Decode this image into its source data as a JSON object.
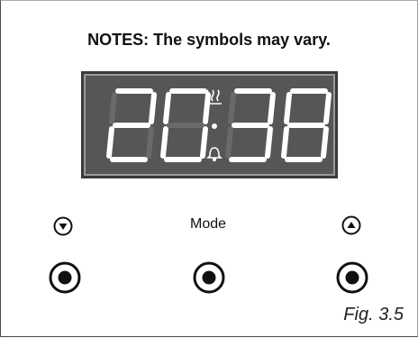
{
  "note": "NOTES: The symbols may vary.",
  "display": {
    "time": "20:38",
    "icons": [
      "heat-waves-icon",
      "bell-icon"
    ],
    "segment_color": "#ffffff",
    "background_color": "#565656"
  },
  "controls": {
    "down_icon": "down-triangle-icon",
    "mode_label": "Mode",
    "up_icon": "up-triangle-icon",
    "knobs": [
      "left-knob",
      "center-knob",
      "right-knob"
    ]
  },
  "caption": "Fig. 3.5"
}
